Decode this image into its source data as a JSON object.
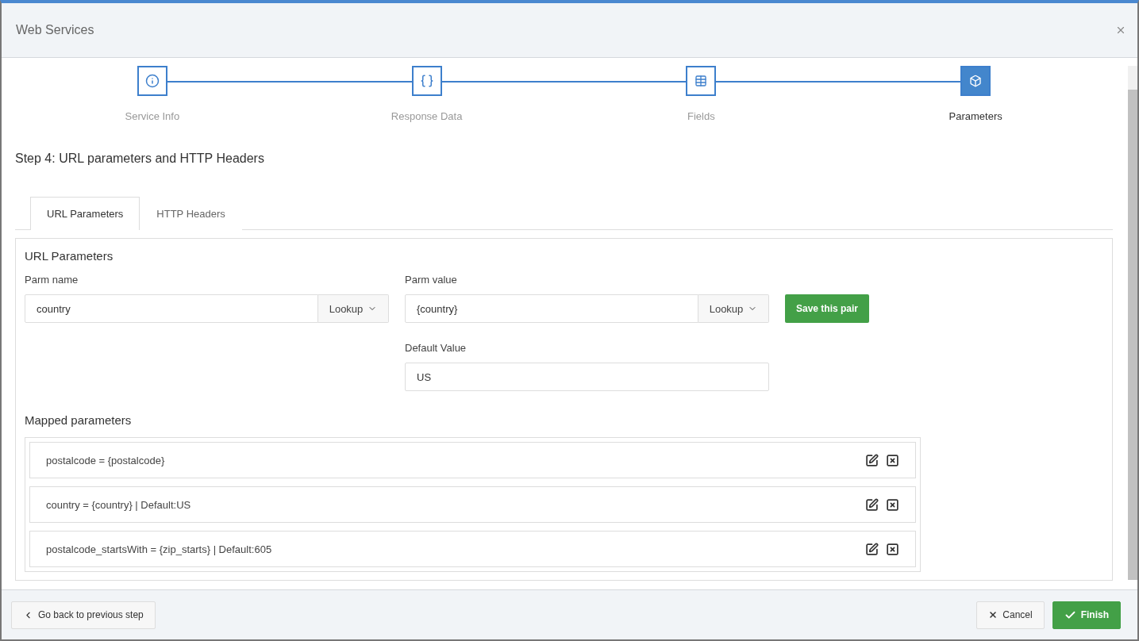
{
  "window": {
    "title": "Web Services"
  },
  "steps": [
    {
      "label": "Service Info",
      "kind": "info",
      "selected": false
    },
    {
      "label": "Response Data",
      "kind": "code",
      "selected": false
    },
    {
      "label": "Fields",
      "kind": "table",
      "selected": false
    },
    {
      "label": "Parameters",
      "kind": "cube",
      "selected": true
    }
  ],
  "heading": "Step 4: URL parameters and HTTP Headers",
  "tabs": [
    {
      "label": "URL Parameters",
      "selected": true
    },
    {
      "label": "HTTP Headers",
      "selected": false
    }
  ],
  "panel": {
    "title": "URL Parameters",
    "parm_name": {
      "label": "Parm name",
      "value": "country",
      "lookup": "Lookup"
    },
    "parm_value": {
      "label": "Parm value",
      "value": "{country}",
      "lookup": "Lookup"
    },
    "default_value": {
      "label": "Default Value",
      "value": "US"
    },
    "save_button": "Save this pair",
    "mapped_title": "Mapped parameters",
    "mapped": [
      "postalcode = {postalcode}",
      "country = {country} | Default:US",
      "postalcode_startsWith = {zip_starts} | Default:605"
    ]
  },
  "footer": {
    "back": "Go back to previous step",
    "cancel": "Cancel",
    "finish": "Finish"
  }
}
